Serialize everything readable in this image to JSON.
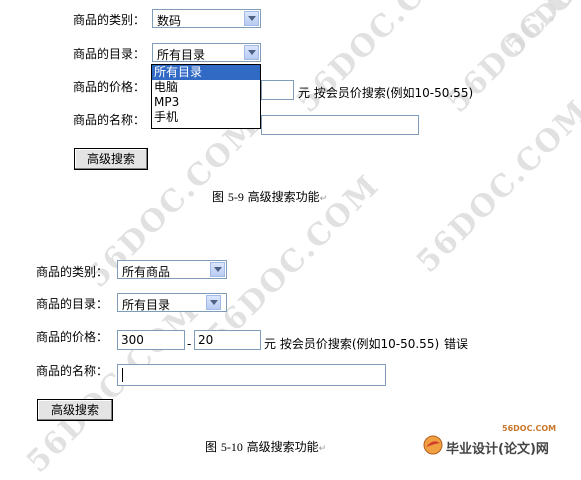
{
  "watermark": {
    "text": "56DOC.COM"
  },
  "figure1": {
    "category_label": "商品的类别：",
    "category_value": "数码",
    "catalog_label": "商品的目录：",
    "catalog_value": "所有目录",
    "catalog_options": [
      "所有目录",
      "电脑",
      "MP3",
      "手机"
    ],
    "price_label": "商品的价格：",
    "price_suffix": "元 按会员价搜索(例如10-50.55)",
    "name_label": "商品的名称：",
    "search_button": "高级搜索",
    "caption_prefix": "图 ",
    "caption_number": "5-9",
    "caption_text": " 高级搜索功能",
    "caption_mark": "↵"
  },
  "figure2": {
    "category_label": "商品的类别：",
    "category_value": "所有商品",
    "catalog_label": "商品的目录：",
    "catalog_value": "所有目录",
    "price_label": "商品的价格：",
    "price_min": "300",
    "price_sep": "-",
    "price_max": "20",
    "price_suffix": "元 按会员价搜索(例如10-50.55)",
    "error_text": "错误",
    "name_label": "商品的名称：",
    "search_button": "高级搜索",
    "caption_prefix": "图 ",
    "caption_number": "5-10",
    "caption_text": " 高级搜索功能",
    "caption_mark": "↵"
  },
  "logo": {
    "domain": "56DOC.COM",
    "text": "毕业设计(论文)网"
  }
}
